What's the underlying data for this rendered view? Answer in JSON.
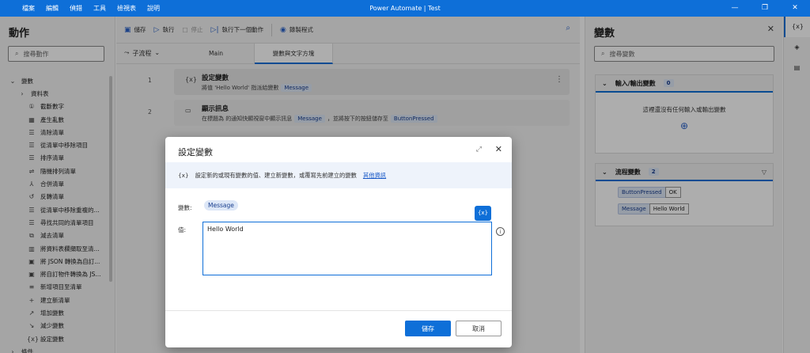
{
  "menu": [
    "檔案",
    "編輯",
    "偵錯",
    "工具",
    "檢視表",
    "說明"
  ],
  "app_title": "Power Automate | Test",
  "window_controls": [
    "—",
    "❐",
    "✕"
  ],
  "actions_pane": {
    "title": "動作",
    "search_placeholder": "搜尋動作",
    "tree": [
      {
        "label": "變數",
        "icon": "chevron-down-icon",
        "indent": 0
      },
      {
        "label": "資料表",
        "icon": "chevron-right-icon",
        "indent": 1
      },
      {
        "label": "截斷數字",
        "icon": "truncate-icon",
        "indent": 2
      },
      {
        "label": "產生亂數",
        "icon": "random-icon",
        "indent": 2
      },
      {
        "label": "清除清單",
        "icon": "list-icon",
        "indent": 2
      },
      {
        "label": "從清單中移除項目",
        "icon": "list-icon",
        "indent": 2
      },
      {
        "label": "排序清單",
        "icon": "list-icon",
        "indent": 2
      },
      {
        "label": "隨機排列清單",
        "icon": "shuffle-icon",
        "indent": 2
      },
      {
        "label": "合併清單",
        "icon": "merge-icon",
        "indent": 2
      },
      {
        "label": "反轉清單",
        "icon": "reverse-icon",
        "indent": 2
      },
      {
        "label": "從清單中移除重複的...",
        "icon": "list-icon",
        "indent": 2
      },
      {
        "label": "尋找共同的清單項目",
        "icon": "list-icon",
        "indent": 2
      },
      {
        "label": "減去清單",
        "icon": "subtract-icon",
        "indent": 2
      },
      {
        "label": "將資料表欄擷取至清...",
        "icon": "table-icon",
        "indent": 2
      },
      {
        "label": "將 JSON 轉換為自訂...",
        "icon": "json-icon",
        "indent": 2
      },
      {
        "label": "將自訂物件轉換為 JS...",
        "icon": "json-icon",
        "indent": 2
      },
      {
        "label": "新增項目至清單",
        "icon": "add-list-icon",
        "indent": 2
      },
      {
        "label": "建立新清單",
        "icon": "plus-icon",
        "indent": 2
      },
      {
        "label": "增加變數",
        "icon": "increase-icon",
        "indent": 2
      },
      {
        "label": "減少變數",
        "icon": "decrease-icon",
        "indent": 2
      },
      {
        "label": "設定變數",
        "icon": "variable-icon",
        "indent": 2
      },
      {
        "label": "條件",
        "icon": "chevron-right-icon",
        "indent": 0
      }
    ]
  },
  "toolbar": {
    "save": "儲存",
    "run": "執行",
    "stop": "停止",
    "run_next": "執行下一個動作",
    "recorder": "錄製程式"
  },
  "tabs": {
    "subflows": "子流程",
    "main": "Main",
    "active": "變數與文字方塊"
  },
  "steps": [
    {
      "num": "1",
      "title": "設定變數",
      "desc_parts": [
        "將值 'Hello World' 指派給變數"
      ],
      "chips": [
        "Message"
      ],
      "icon_text": "{x}"
    },
    {
      "num": "2",
      "title": "顯示訊息",
      "desc_prefix": "在標題為  的通知快顯視窗中顯示訊息",
      "chip1": "Message",
      "desc_mid": "，並將按下的按鈕儲存至",
      "chip2": "ButtonPressed",
      "icon_text": "💬"
    }
  ],
  "variables_pane": {
    "title": "變數",
    "search_placeholder": "搜尋變數",
    "io_section": {
      "title": "輸入/輸出變數",
      "count": "0",
      "empty": "這裡還沒有任何輸入或輸出變數"
    },
    "flow_section": {
      "title": "流程變數",
      "count": "2",
      "vars": [
        {
          "name": "ButtonPressed",
          "value": "OK"
        },
        {
          "name": "Message",
          "value": "Hello World"
        }
      ]
    }
  },
  "dialog": {
    "title": "設定變數",
    "info_icon": "{x}",
    "info_text": "設定新的或現有變數的值、建立新變數，或覆寫先前建立的變數",
    "info_link": "其他資訊",
    "variable_label": "變數:",
    "variable_name": "Message",
    "value_label": "值:",
    "value": "Hello World",
    "fx_label": "{x}",
    "save": "儲存",
    "cancel": "取消"
  },
  "colors": {
    "accent": "#0e6fd8",
    "chip_bg": "#dde7f7"
  }
}
